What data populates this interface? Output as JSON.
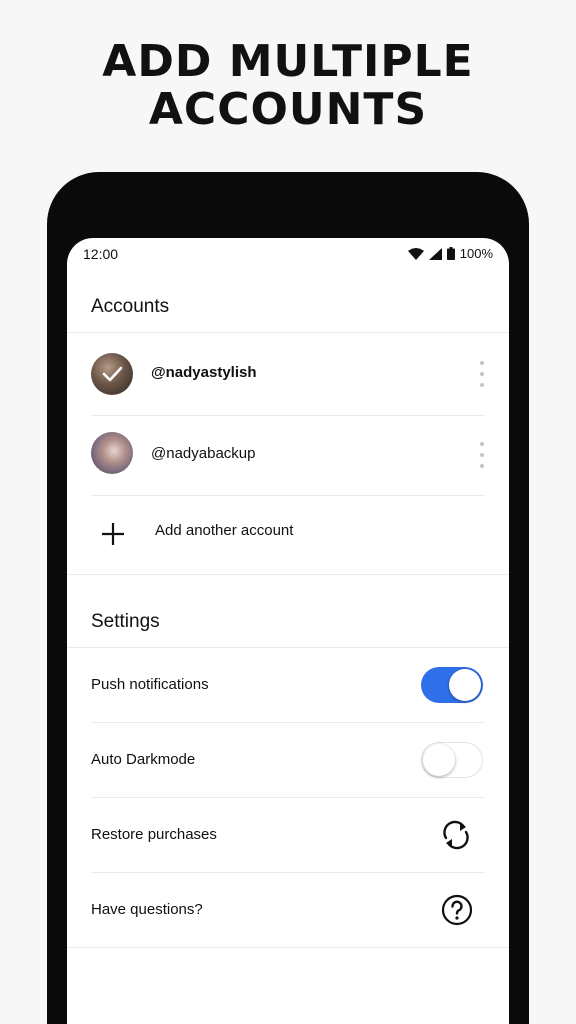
{
  "headline": {
    "line1": "ADD MULTIPLE",
    "line2": "ACCOUNTS"
  },
  "status_bar": {
    "time": "12:00",
    "battery": "100%",
    "icons": [
      "wifi-icon",
      "signal-icon",
      "battery-icon"
    ]
  },
  "accounts": {
    "title": "Accounts",
    "items": [
      {
        "username": "@nadyastylish",
        "active": true
      },
      {
        "username": "@nadyabackup",
        "active": false
      }
    ],
    "add_label": "Add another account"
  },
  "settings": {
    "title": "Settings",
    "items": [
      {
        "label": "Push notifications",
        "control": "toggle",
        "enabled": true
      },
      {
        "label": "Auto Darkmode",
        "control": "toggle",
        "enabled": false
      },
      {
        "label": "Restore purchases",
        "control": "icon",
        "icon": "refresh-icon"
      },
      {
        "label": "Have questions?",
        "control": "icon",
        "icon": "help-icon"
      }
    ]
  },
  "colors": {
    "accent": "#2f6fea",
    "text": "#111111",
    "background": "#f7f7f7",
    "phone": "#0a0a0a"
  }
}
